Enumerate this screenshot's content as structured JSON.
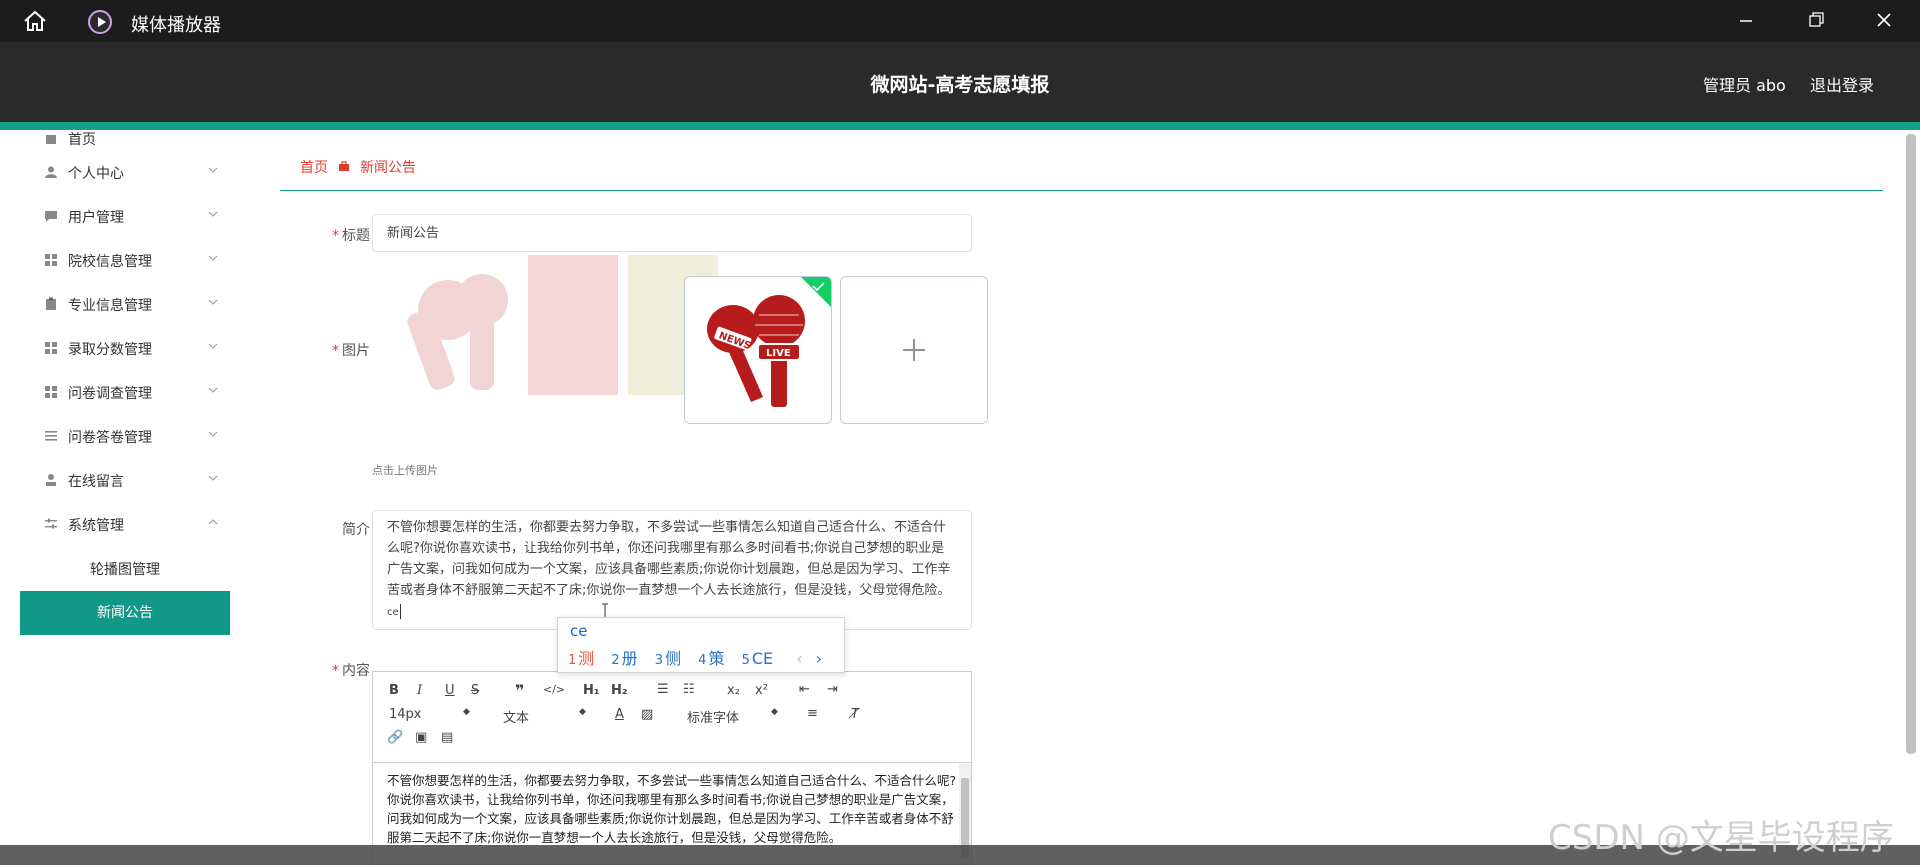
{
  "window": {
    "title": "媒体播放器"
  },
  "header": {
    "site_title": "微网站-高考志愿填报",
    "admin_label": "管理员 abo",
    "logout_label": "退出登录"
  },
  "sidebar": {
    "top_partial": "首页",
    "items": [
      {
        "label": "个人中心",
        "icon": "user-icon"
      },
      {
        "label": "用户管理",
        "icon": "chat-icon"
      },
      {
        "label": "院校信息管理",
        "icon": "grid-icon"
      },
      {
        "label": "专业信息管理",
        "icon": "clipboard-icon"
      },
      {
        "label": "录取分数管理",
        "icon": "grid-icon"
      },
      {
        "label": "问卷调查管理",
        "icon": "grid-icon"
      },
      {
        "label": "问卷答卷管理",
        "icon": "list-icon"
      },
      {
        "label": "在线留言",
        "icon": "person-icon"
      },
      {
        "label": "系统管理",
        "icon": "sliders-icon"
      }
    ],
    "sub_items": [
      {
        "label": "轮播图管理",
        "active": false
      },
      {
        "label": "新闻公告",
        "active": true
      }
    ]
  },
  "breadcrumb": {
    "home": "首页",
    "current": "新闻公告"
  },
  "form": {
    "title_label": "标题",
    "title_value": "新闻公告",
    "image_label": "图片",
    "upload_hint": "点击上传图片",
    "news_badge": "NEWS",
    "live_badge": "LIVE",
    "intro_label": "简介",
    "intro_value": "不管你想要怎样的生活，你都要去努力争取，不多尝试一些事情怎么知道自己适合什么、不适合什么呢?你说你喜欢读书，让我给你列书单，你还问我哪里有那么多时间看书;你说自己梦想的职业是广告文案，问我如何成为一个文案，应该具备哪些素质;你说你计划晨跑，但总是因为学习、工作辛苦或者身体不舒服第二天起不了床;你说你一直梦想一个人去长途旅行，但是没钱，父母觉得危险。",
    "intro_typed": "ce",
    "content_label": "内容"
  },
  "ime": {
    "composition": "ce",
    "candidates": [
      {
        "n": "1",
        "text": "测"
      },
      {
        "n": "2",
        "text": "册"
      },
      {
        "n": "3",
        "text": "侧"
      },
      {
        "n": "4",
        "text": "策"
      },
      {
        "n": "5",
        "text": "CE"
      }
    ],
    "prev": "‹",
    "next": "›"
  },
  "editor": {
    "font_size": "14px",
    "block_format": "文本",
    "font_family": "标准字体",
    "body_line1": "不管你想要怎样的生活，你都要去努力争取，不多尝试一些事情怎么知道自己适合什么、不适合什么呢?",
    "body_line2": "你说你喜欢读书，让我给你列书单，你还问我哪里有那么多时间看书;你说自己梦想的职业是广告文案，问我如何成为一个文案，应该具备哪些素质;你说你计划晨跑，但总是因为学习、工作辛苦或者身体不舒服第二天起不了床;你说你一直梦想一个人去长途旅行，但是没钱，父母觉得危险。"
  },
  "watermark": "CSDN @文星毕设程序",
  "colors": {
    "accent": "#17a08a",
    "active_bg": "#119887",
    "breadcrumb": "#e03e2d",
    "header_bg": "#2a2a2a"
  }
}
